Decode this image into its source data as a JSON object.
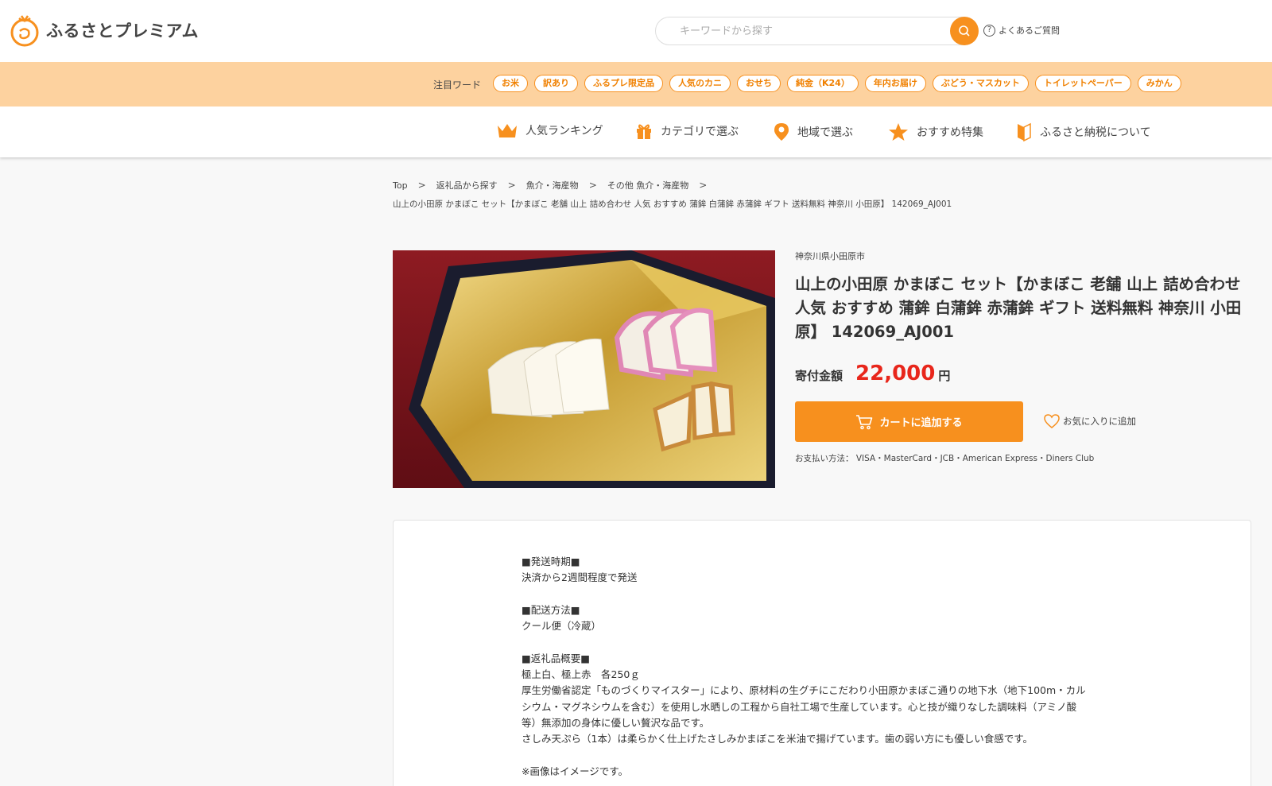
{
  "header": {
    "logo_text": "ふるさとプレミアム",
    "search_placeholder": "キーワードから探す",
    "faq_label": "よくあるご質問"
  },
  "keywords": {
    "label": "注目ワード",
    "items": [
      "お米",
      "訳あり",
      "ふるプレ限定品",
      "人気のカニ",
      "おせち",
      "純金（K24）",
      "年内お届け",
      "ぶどう・マスカット",
      "トイレットペーパー",
      "みかん"
    ]
  },
  "nav": {
    "items": [
      {
        "label": "人気ランキング",
        "icon": "crown-icon"
      },
      {
        "label": "カテゴリで選ぶ",
        "icon": "gift-icon"
      },
      {
        "label": "地域で選ぶ",
        "icon": "map-pin-icon"
      },
      {
        "label": "おすすめ特集",
        "icon": "star-icon"
      },
      {
        "label": "ふるさと納税について",
        "icon": "beginner-mark-icon"
      }
    ]
  },
  "breadcrumb": {
    "items": [
      "Top",
      "返礼品から探す",
      "魚介・海産物",
      "その他 魚介・海産物"
    ],
    "current": "山上の小田原 かまぼこ セット【かまぼこ 老舗 山上 詰め合わせ 人気 おすすめ 蒲鉾 白蒲鉾 赤蒲鉾 ギフト 送料無料 神奈川 小田原】 142069_AJ001"
  },
  "product": {
    "region": "神奈川県小田原市",
    "title": "山上の小田原 かまぼこ セット【かまぼこ 老舗 山上 詰め合わせ 人気 おすすめ 蒲鉾 白蒲鉾 赤蒲鉾 ギフト 送料無料 神奈川 小田原】 142069_AJ001",
    "price_label": "寄付金額",
    "price_value": "22,000",
    "price_unit": "円",
    "cart_label": "カートに追加する",
    "favorite_label": "お気に入りに追加",
    "payment": "お支払い方法： VISA・MasterCard・JCB・American Express・Diners Club"
  },
  "description": {
    "lines": [
      "■発送時期■",
      "決済から2週間程度で発送",
      "",
      "■配送方法■",
      "クール便（冷蔵）",
      "",
      "■返礼品概要■",
      "極上白、極上赤　各250ｇ",
      "厚生労働省認定「ものづくりマイスター」により、原材料の生グチにこだわり小田原かまぼこ通りの地下水（地下100m・カル",
      "シウム・マグネシウムを含む）を使用し水晒しの工程から自社工場で生産しています。心と技が織りなした調味料（アミノ酸",
      "等）無添加の身体に優しい贅沢な品です。",
      "さしみ天ぷら（1本）は柔らかく仕上げたさしみかまぼこを米油で揚げています。歯の弱い方にも優しい食感です。",
      "",
      "※画像はイメージです。"
    ]
  },
  "colors": {
    "accent": "#f7901e",
    "keyword_bar": "#fdd29f",
    "price": "#e8261b"
  }
}
